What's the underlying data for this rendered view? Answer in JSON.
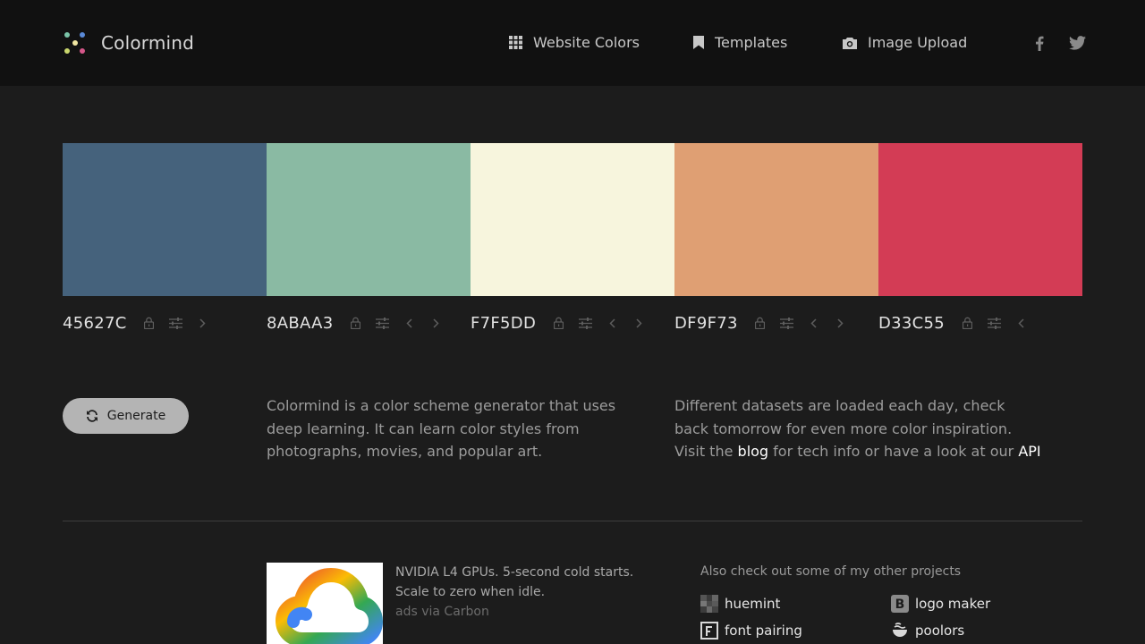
{
  "header": {
    "brand": "Colormind",
    "nav": [
      {
        "label": "Website Colors",
        "icon": "grid-icon"
      },
      {
        "label": "Templates",
        "icon": "bookmark-icon"
      },
      {
        "label": "Image Upload",
        "icon": "camera-icon"
      }
    ],
    "social": [
      "facebook-icon",
      "twitter-icon"
    ]
  },
  "palette": {
    "swatches": [
      {
        "hex": "45627C",
        "color": "#45627C",
        "controls": [
          "lock-icon",
          "adjust-icon",
          "chevron-right-icon"
        ]
      },
      {
        "hex": "8ABAA3",
        "color": "#8ABAA3",
        "controls": [
          "lock-icon",
          "adjust-icon",
          "chevron-left-icon",
          "chevron-right-icon"
        ]
      },
      {
        "hex": "F7F5DD",
        "color": "#F7F5DD",
        "controls": [
          "lock-icon",
          "adjust-icon",
          "chevron-left-icon",
          "chevron-right-icon"
        ]
      },
      {
        "hex": "DF9F73",
        "color": "#DF9F73",
        "controls": [
          "lock-icon",
          "adjust-icon",
          "chevron-left-icon",
          "chevron-right-icon"
        ]
      },
      {
        "hex": "D33C55",
        "color": "#D33C55",
        "controls": [
          "lock-icon",
          "adjust-icon",
          "chevron-left-icon"
        ]
      }
    ]
  },
  "generate": {
    "label": "Generate",
    "icon": "refresh-icon"
  },
  "intro": {
    "text": "Colormind is a color scheme generator that uses deep learning. It can learn color styles from photographs, movies, and popular art."
  },
  "datasets": {
    "text_before": "Different datasets are loaded each day, check back tomorrow for even more color inspiration. Visit the ",
    "blog_link": "blog",
    "text_middle": " for tech info or have a look at our ",
    "api_link": "API"
  },
  "ad": {
    "text": "NVIDIA L4 GPUs. 5-second cold starts. Scale to zero when idle.",
    "via": "ads via Carbon",
    "image_icon": "cloud-logo-icon"
  },
  "projects": {
    "heading": "Also check out some of my other projects",
    "items": [
      {
        "label": "huemint",
        "icon": "huemint-icon"
      },
      {
        "label": "logo maker",
        "icon": "logo-maker-icon"
      },
      {
        "label": "font pairing",
        "icon": "font-pairing-icon"
      },
      {
        "label": "poolors",
        "icon": "poolors-icon"
      }
    ]
  },
  "colors": {
    "header_bg": "#111111",
    "page_bg": "#1c1c1c",
    "button_bg": "#b4b4b4",
    "link": "#ffffff"
  }
}
